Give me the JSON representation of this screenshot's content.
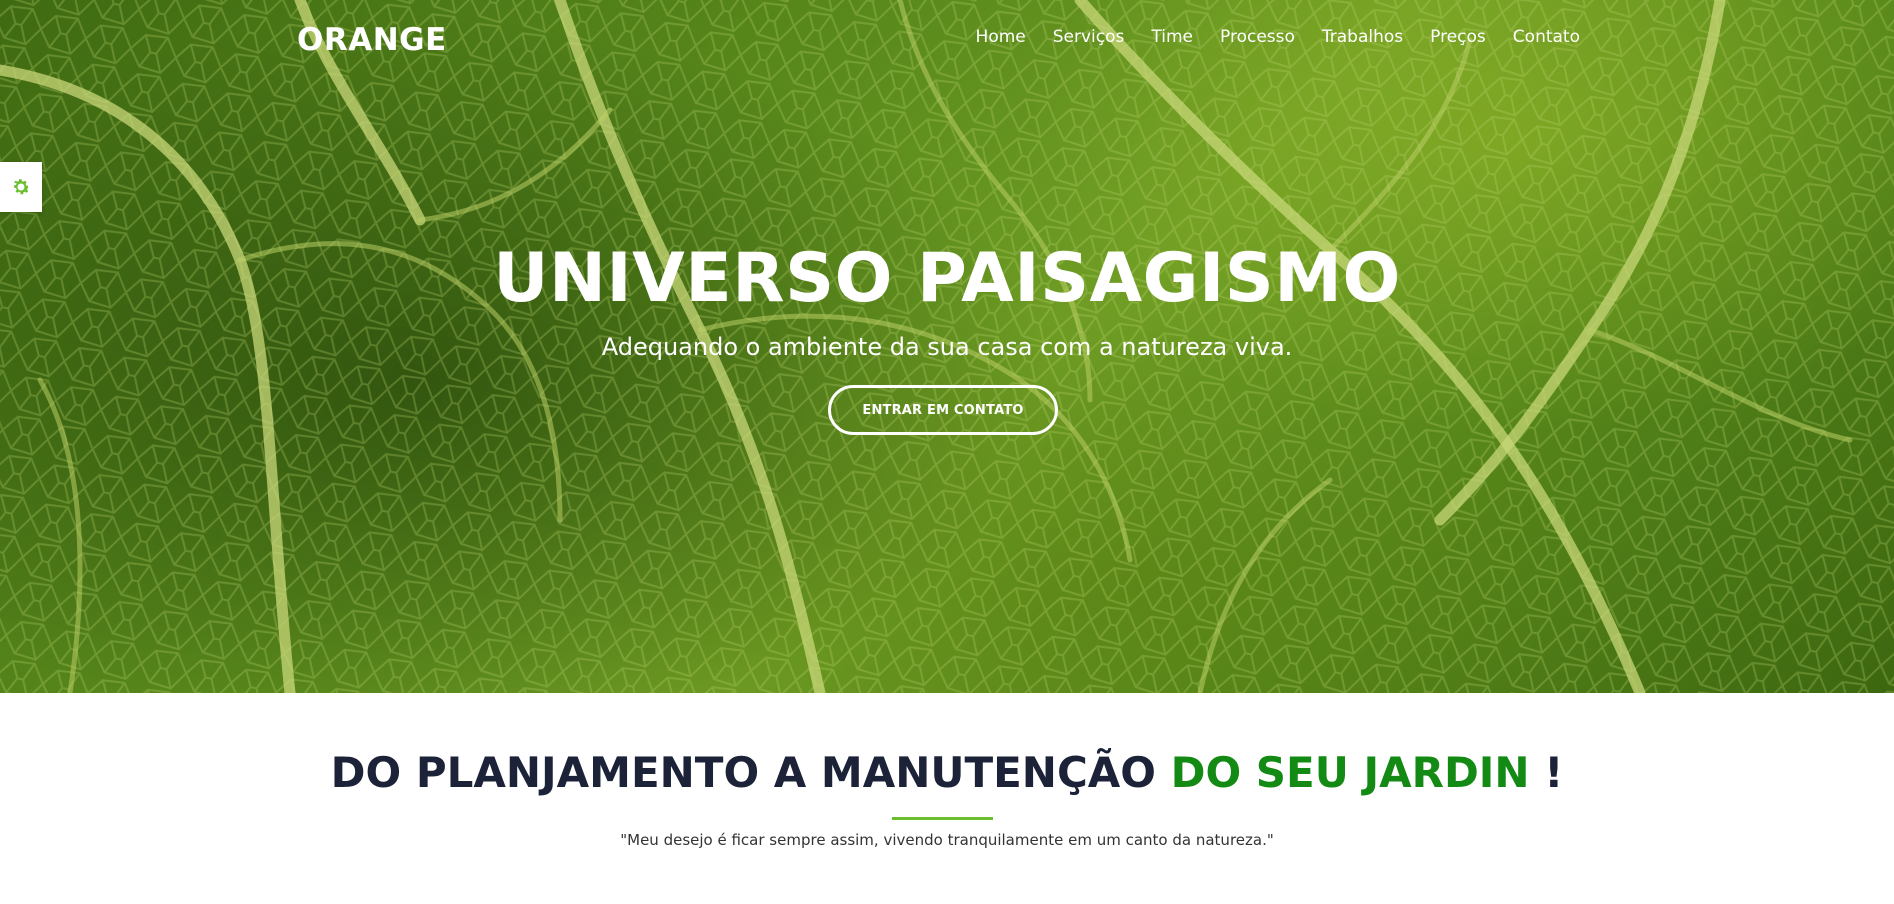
{
  "header": {
    "logo": "ORANGE",
    "nav": [
      {
        "label": "Home"
      },
      {
        "label": "Serviços"
      },
      {
        "label": "Time"
      },
      {
        "label": "Processo"
      },
      {
        "label": "Trabalhos"
      },
      {
        "label": "Preços"
      },
      {
        "label": "Contato"
      }
    ]
  },
  "settings": {
    "icon": "gear-icon",
    "color": "#6bbf2e"
  },
  "hero": {
    "title": "UNIVERSO PAISAGISMO",
    "subtitle": "Adequando o ambiente da sua casa com a natureza viva.",
    "cta_label": "ENTRAR EM CONTATO"
  },
  "intro": {
    "title_main": "DO PLANJAMENTO A MANUTENÇÃO",
    "title_accent": "DO SEU JARDIN",
    "title_end": "!",
    "quote": "\"Meu desejo é ficar sempre assim, vivendo tranquilamente em um canto da natureza.\""
  },
  "colors": {
    "accent_green": "#138a13",
    "divider_green": "#6bbf2e",
    "heading_navy": "#1c2238"
  }
}
